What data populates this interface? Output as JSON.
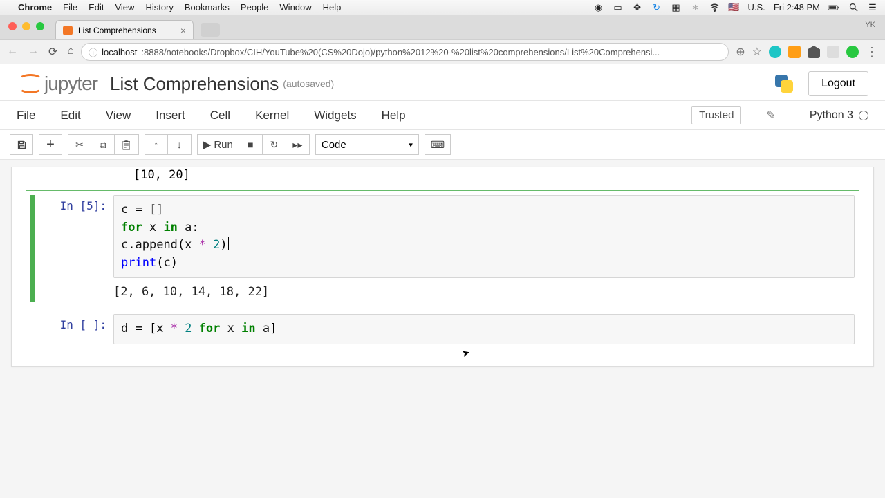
{
  "mac": {
    "menus": [
      "Chrome",
      "File",
      "Edit",
      "View",
      "History",
      "Bookmarks",
      "People",
      "Window",
      "Help"
    ],
    "locale": "U.S.",
    "time": "Fri 2:48 PM"
  },
  "chrome": {
    "tab_title": "List Comprehensions",
    "user": "YK",
    "url_host": "localhost",
    "url_port_path": ":8888/notebooks/Dropbox/CIH/YouTube%20(CS%20Dojo)/python%2012%20-%20list%20comprehensions/List%20Comprehensi..."
  },
  "jupyter": {
    "logo_text": "jupyter",
    "title": "List Comprehensions",
    "autosave": "(autosaved)",
    "logout": "Logout",
    "menus": [
      "File",
      "Edit",
      "View",
      "Insert",
      "Cell",
      "Kernel",
      "Widgets",
      "Help"
    ],
    "trusted": "Trusted",
    "kernel": "Python 3",
    "run_label": "Run",
    "cell_type": "Code"
  },
  "cells": {
    "prev_output": "[10, 20]",
    "c5_prompt": "In [5]:",
    "c5_output": "[2, 6, 10, 14, 18, 22]",
    "c5_code": {
      "l1_var": "c",
      "l1_eq": " = ",
      "l1_br": "[]",
      "l2_for": "for",
      "l2_x": " x ",
      "l2_in": "in",
      "l2_a": " a",
      "l2_colon": ":",
      "l3_indent": "    ",
      "l3_c": "c",
      "l3_dot": ".",
      "l3_ap": "append",
      "l3_op": "(",
      "l3_x": "x ",
      "l3_star": "*",
      "l3_two": " 2",
      "l3_cp": ")",
      "l4_print": "print",
      "l4_op": "(",
      "l4_c": "c",
      "l4_cp": ")"
    },
    "c6_prompt": "In [ ]:",
    "c6_code": {
      "d": "d",
      "eq": " = ",
      "ob": "[",
      "x1": "x ",
      "star": "*",
      "two": " 2 ",
      "for": "for",
      "x2": " x ",
      "in": "in",
      "a": " a",
      "cb": "]"
    }
  }
}
